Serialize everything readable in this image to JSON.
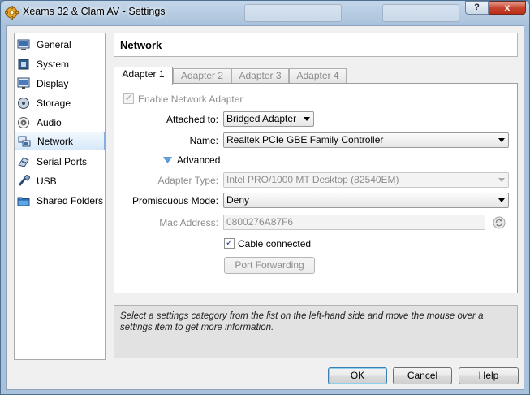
{
  "window": {
    "title": "Xeams 32 & Clam AV - Settings",
    "help_label": "?",
    "close_label": "x"
  },
  "sidebar": {
    "items": [
      {
        "label": "General",
        "icon": "general-icon"
      },
      {
        "label": "System",
        "icon": "system-icon"
      },
      {
        "label": "Display",
        "icon": "display-icon"
      },
      {
        "label": "Storage",
        "icon": "storage-icon"
      },
      {
        "label": "Audio",
        "icon": "audio-icon"
      },
      {
        "label": "Network",
        "icon": "network-icon",
        "selected": true
      },
      {
        "label": "Serial Ports",
        "icon": "serial-ports-icon"
      },
      {
        "label": "USB",
        "icon": "usb-icon"
      },
      {
        "label": "Shared Folders",
        "icon": "shared-folders-icon"
      }
    ]
  },
  "main": {
    "title": "Network",
    "tabs": [
      {
        "label": "Adapter 1",
        "active": true
      },
      {
        "label": "Adapter 2"
      },
      {
        "label": "Adapter 3"
      },
      {
        "label": "Adapter 4"
      }
    ],
    "enable_adapter": {
      "label": "Enable Network Adapter",
      "checked": true,
      "enabled": false
    },
    "attached_to": {
      "label": "Attached to:",
      "value": "Bridged Adapter"
    },
    "name": {
      "label": "Name:",
      "value": "Realtek PCIe GBE Family Controller"
    },
    "advanced_label": "Advanced",
    "adapter_type": {
      "label": "Adapter Type:",
      "value": "Intel PRO/1000 MT Desktop (82540EM)"
    },
    "promiscuous_mode": {
      "label": "Promiscuous Mode:",
      "value": "Deny"
    },
    "mac_address": {
      "label": "Mac Address:",
      "value": "0800276A87F6"
    },
    "cable_connected": {
      "label": "Cable connected",
      "checked": true
    },
    "port_forwarding_label": "Port Forwarding"
  },
  "info_text": "Select a settings category from the list on the left-hand side and move the mouse over a settings item to get more information.",
  "buttons": {
    "ok": "OK",
    "cancel": "Cancel",
    "help": "Help"
  },
  "colors": {
    "selection_border": "#84acdd",
    "default_button_border": "#3c7fb1",
    "titlebar": "#a9c2dc"
  }
}
